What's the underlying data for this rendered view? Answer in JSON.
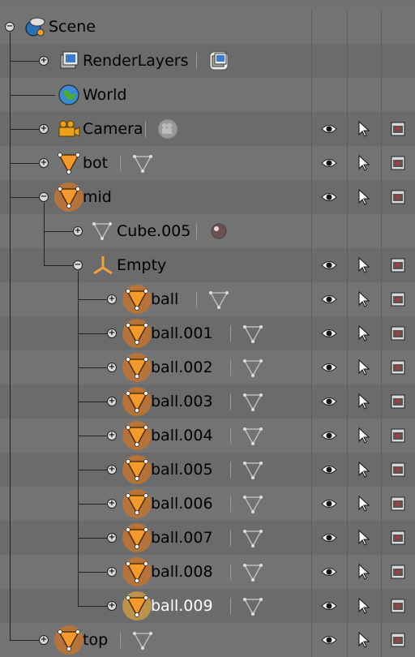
{
  "outliner": {
    "rows": [
      {
        "label": "Scene",
        "type": "scene",
        "depth": 0,
        "expander": "minus",
        "data_icon": null,
        "visibility": false
      },
      {
        "label": "RenderLayers",
        "type": "renderlayers",
        "depth": 1,
        "expander": "plus",
        "data_icon": "renderlayer",
        "visibility": false
      },
      {
        "label": "World",
        "type": "world",
        "depth": 1,
        "expander": null,
        "data_icon": null,
        "visibility": false
      },
      {
        "label": "Camera",
        "type": "camera",
        "depth": 1,
        "expander": "plus",
        "data_icon": "camera-data",
        "visibility": true
      },
      {
        "label": "bot",
        "type": "mesh",
        "depth": 1,
        "expander": "plus",
        "data_icon": "mesh-data",
        "visibility": true
      },
      {
        "label": "mid",
        "type": "mesh",
        "depth": 1,
        "expander": "minus",
        "data_icon": null,
        "visibility": true,
        "halo": true
      },
      {
        "label": "Cube.005",
        "type": "meshdata",
        "depth": 2,
        "expander": "plus",
        "data_icon": "material",
        "visibility": false
      },
      {
        "label": "Empty",
        "type": "empty",
        "depth": 2,
        "expander": "minus",
        "data_icon": null,
        "visibility": true
      },
      {
        "label": "ball",
        "type": "mesh",
        "depth": 3,
        "expander": "plus",
        "data_icon": "mesh-data",
        "visibility": true,
        "halo": true
      },
      {
        "label": "ball.001",
        "type": "mesh",
        "depth": 3,
        "expander": "plus",
        "data_icon": "mesh-data",
        "visibility": true,
        "halo": true
      },
      {
        "label": "ball.002",
        "type": "mesh",
        "depth": 3,
        "expander": "plus",
        "data_icon": "mesh-data",
        "visibility": true,
        "halo": true
      },
      {
        "label": "ball.003",
        "type": "mesh",
        "depth": 3,
        "expander": "plus",
        "data_icon": "mesh-data",
        "visibility": true,
        "halo": true
      },
      {
        "label": "ball.004",
        "type": "mesh",
        "depth": 3,
        "expander": "plus",
        "data_icon": "mesh-data",
        "visibility": true,
        "halo": true
      },
      {
        "label": "ball.005",
        "type": "mesh",
        "depth": 3,
        "expander": "plus",
        "data_icon": "mesh-data",
        "visibility": true,
        "halo": true
      },
      {
        "label": "ball.006",
        "type": "mesh",
        "depth": 3,
        "expander": "plus",
        "data_icon": "mesh-data",
        "visibility": true,
        "halo": true
      },
      {
        "label": "ball.007",
        "type": "mesh",
        "depth": 3,
        "expander": "plus",
        "data_icon": "mesh-data",
        "visibility": true,
        "halo": true
      },
      {
        "label": "ball.008",
        "type": "mesh",
        "depth": 3,
        "expander": "plus",
        "data_icon": "mesh-data",
        "visibility": true,
        "halo": true
      },
      {
        "label": "ball.009",
        "type": "mesh",
        "depth": 3,
        "expander": "plus",
        "data_icon": "mesh-data",
        "visibility": true,
        "halo": true,
        "active": true
      },
      {
        "label": "top",
        "type": "mesh",
        "depth": 1,
        "expander": "plus",
        "data_icon": "mesh-data",
        "visibility": true,
        "halo": true
      }
    ],
    "restrict_columns": [
      "eye-icon",
      "cursor-icon",
      "camera-render-icon"
    ]
  },
  "colors": {
    "row_odd": "#737373",
    "row_even": "#6b6b6b",
    "halo": "#c07431",
    "halo_active": "#c99a47",
    "mesh_orange": "#e8891e",
    "active_text": "#ffffff"
  }
}
